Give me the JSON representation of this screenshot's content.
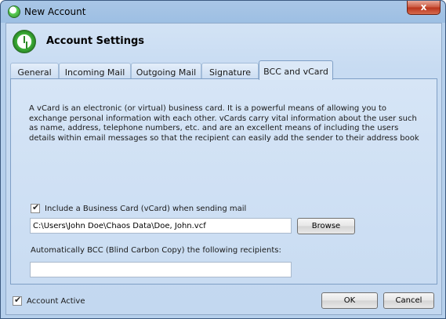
{
  "window": {
    "title": "New Account",
    "close_glyph": "x"
  },
  "header": {
    "icon": "account-clock-icon",
    "title": "Account Settings"
  },
  "tabs": [
    {
      "label": "General",
      "active": false
    },
    {
      "label": "Incoming Mail",
      "active": false
    },
    {
      "label": "Outgoing Mail",
      "active": false
    },
    {
      "label": "Signature",
      "active": false
    },
    {
      "label": "BCC and vCard",
      "active": true
    }
  ],
  "panel": {
    "description": "A vCard is an electronic (or virtual) business card. It is a powerful means of allowing you to exchange personal information with each other. vCards carry vital information about the user such as name, address, telephone numbers, etc. and are an excellent means of including the users details within email messages so that the recipient can easily add the sender to their address book",
    "include_vcard": {
      "checked": true,
      "label": "Include a Business Card (vCard) when sending mail"
    },
    "vcard_path": "C:\\Users\\John Doe\\Chaos Data\\Doe, John.vcf",
    "browse_label": "Browse",
    "bcc_label": "Automatically BCC (Blind Carbon Copy) the following recipients:",
    "bcc_value": ""
  },
  "footer": {
    "account_active": {
      "checked": true,
      "label": "Account Active"
    },
    "ok_label": "OK",
    "cancel_label": "Cancel"
  },
  "colors": {
    "title_bar": "#a9c6e6",
    "client_bg": "#c7dbf2",
    "close_button": "#c9543c"
  }
}
